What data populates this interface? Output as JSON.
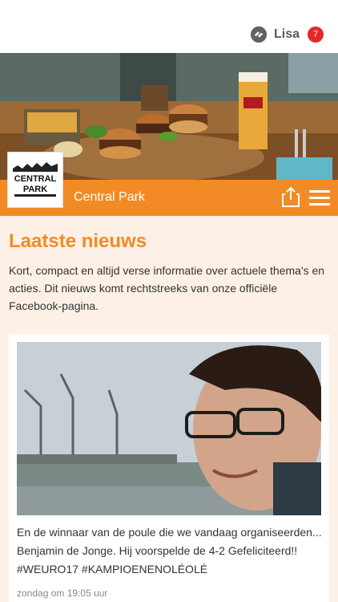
{
  "user": {
    "name": "Lisa",
    "notification_count": "7"
  },
  "venue": {
    "name": "Central Park",
    "logo_text_top": "CENTRAL",
    "logo_text_bottom": "PARK"
  },
  "news": {
    "title": "Laatste nieuws",
    "intro": "Kort, compact en altijd verse informatie over actuele thema's en acties. Dit nieuws komt rechtstreeks van onze officiële Facebook-pagina."
  },
  "posts": [
    {
      "text": "En de winnaar van de poule die we vandaag organiseerden... Benjamin de Jonge. Hij voorspelde de 4-2 Gefeliciteerd!! #WEURO17 #KAMPIOENENOLÉOLÉ",
      "time": "zondag om 19:05 uur"
    }
  ],
  "colors": {
    "accent": "#f28b25",
    "badge": "#e8262a",
    "background": "#fdf1e7"
  },
  "icons": {
    "user": "sync-logo-icon",
    "share": "share-icon",
    "menu": "hamburger-menu-icon"
  }
}
